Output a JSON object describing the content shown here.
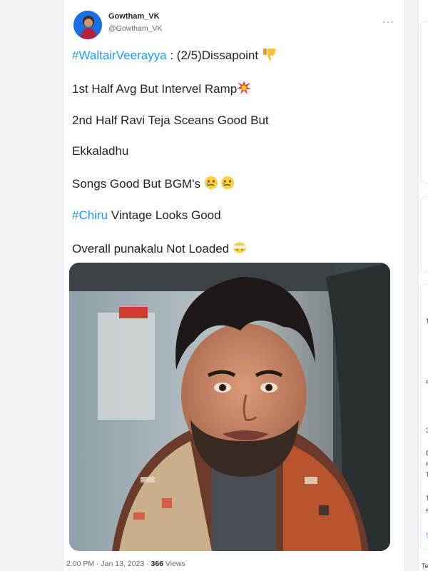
{
  "tweet": {
    "display_name": "Gowtham_VK",
    "handle": "@Gowtham_VK",
    "more_label": "···",
    "lines": {
      "l1_tag": "#WaltairVeerayya",
      "l1_text": " : (2/5)Dissapoint ",
      "l2_text": "1st Half Avg But Intervel Ramp",
      "l3_text": "2nd Half Ravi Teja Sceans Good But",
      "l4_text": "Ekkaladhu",
      "l5_text": "Songs Good But BGM's ",
      "l6_tag": "#Chiru",
      "l6_text": " Vintage Looks Good",
      "l7_text": "Overall punakalu Not Loaded "
    },
    "emojis": {
      "thumbs_down": "thumbs-down-icon",
      "boom": "collision-icon",
      "crying": "crying-face-icon",
      "bandage": "bandaged-face-icon"
    },
    "meta": {
      "time": "2:00 PM · Jan 13, 2023 · ",
      "views_count": "366",
      "views_label": " Views"
    }
  },
  "sidebar": {
    "frag_1": "T",
    "frag_2": "#",
    "frag_3": "3",
    "frag_4": "E",
    "frag_5": "#",
    "frag_6": "T",
    "frag_7": "T",
    "frag_8": "#",
    "frag_9": "S",
    "frag_10": "Te"
  },
  "colors": {
    "link": "#1d9bf0",
    "background": "#f2f3f4"
  }
}
